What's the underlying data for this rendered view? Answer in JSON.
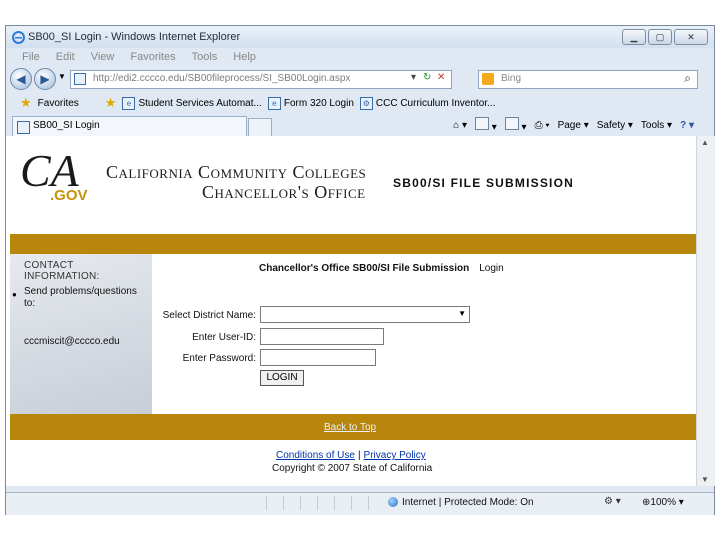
{
  "browser": {
    "title": "SB00_SI Login - Windows Internet Explorer",
    "menu": [
      "File",
      "Edit",
      "View",
      "Favorites",
      "Tools",
      "Help"
    ],
    "url": "http://edi2.cccco.edu/SB00fileprocess/SI_SB00Login.aspx",
    "search_placeholder": "Bing",
    "favorites_label": "Favorites",
    "favorites": [
      "Student Services Automat...",
      "Form 320 Login",
      "CCC Curriculum Inventor..."
    ],
    "tab_title": "SB00_SI Login",
    "commands": [
      "Page",
      "Safety",
      "Tools"
    ],
    "status_zone": "Internet | Protected Mode: On",
    "zoom": "100%"
  },
  "page": {
    "org_line1": "California Community Colleges",
    "org_line2": "Chancellor's Office",
    "logo_text": "CA",
    "logo_gov": ".GOV",
    "app_title": "SB00/SI FILE SUBMISSION",
    "contact_header": "CONTACT INFORMATION:",
    "contact_text": "Send problems/questions to:",
    "contact_email": "cccmiscit@cccco.edu",
    "form_title": "Chancellor's Office SB00/SI File Submission",
    "form_subtitle": "Login",
    "district_label": "Select District Name:",
    "user_label": "Enter User-ID:",
    "password_label": "Enter Password:",
    "login_button": "LOGIN",
    "back_to_top": "Back to Top",
    "conditions_link": "Conditions of Use",
    "privacy_link": "Privacy Policy",
    "copyright": "Copyright © 2007 State of California"
  },
  "colors": {
    "gold": "#b8860b",
    "link": "#0033aa"
  }
}
